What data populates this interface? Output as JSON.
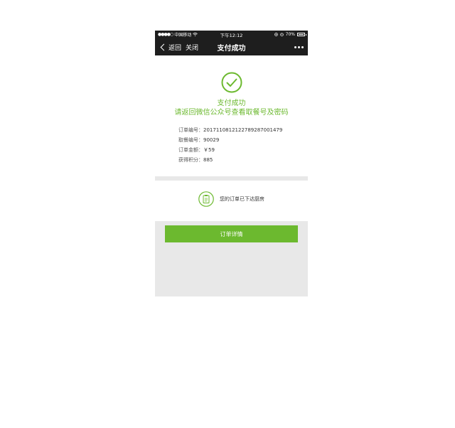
{
  "status_bar": {
    "signal": "●●●●○",
    "carrier": "中国移动",
    "time": "下午12:12",
    "battery": "70%"
  },
  "nav": {
    "back_label": "返回",
    "close_label": "关闭",
    "title": "支付成功"
  },
  "result": {
    "title": "支付成功",
    "subtitle": "请返回微信公众号查看取餐号及密码",
    "accent_color": "#6cb92f"
  },
  "order_info": [
    {
      "label": "订单编号：",
      "value": "2017110812122789287001479"
    },
    {
      "label": "取餐编号：",
      "value": "90029"
    },
    {
      "label": "订单金额：",
      "value": "￥59"
    },
    {
      "label": "获得积分：",
      "value": "885"
    }
  ],
  "notice": {
    "icon": "clipboard-icon",
    "text": "您的订单已下达厨房"
  },
  "detail_button": {
    "label": "订单详情"
  }
}
